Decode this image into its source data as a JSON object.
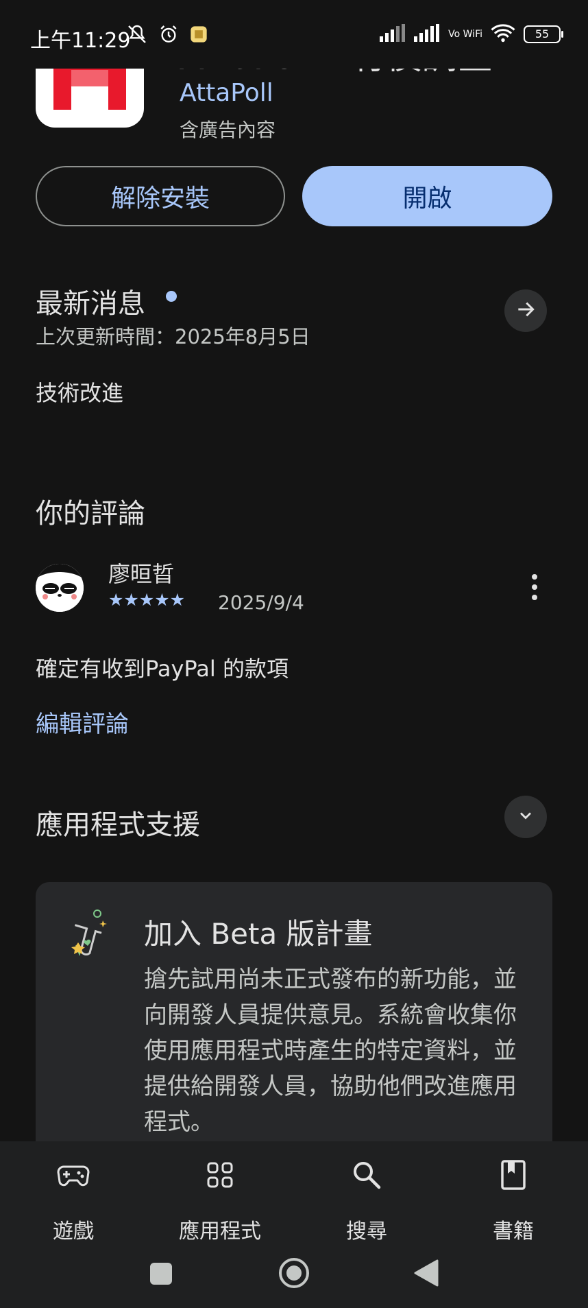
{
  "status_bar": {
    "time": "上午11:29",
    "battery": "55",
    "network_label": "Vo WiFi"
  },
  "app": {
    "title": "AttaPoll - 有償調查",
    "developer": "AttaPoll",
    "ads_note": "含廣告內容",
    "uninstall_label": "解除安裝",
    "open_label": "開啟",
    "icon_color": "#e8192c"
  },
  "whats_new": {
    "title": "最新消息",
    "updated": "上次更新時間：2025年8月5日",
    "notes": "技術改進"
  },
  "your_review": {
    "title": "你的評論",
    "reviewer": "廖晅晢",
    "rating": 5,
    "stars": "★★★★★",
    "date": "2025/9/4",
    "text": "確定有收到PayPal 的款項",
    "edit_label": "編輯評論"
  },
  "app_support": {
    "title": "應用程式支援"
  },
  "beta": {
    "title": "加入 Beta 版計畫",
    "description": "搶先試用尚未正式發布的新功能，並向開發人員提供意見。系統會收集你使用應用程式時產生的特定資料，並提供給開發人員，協助他們改進應用程式。"
  },
  "bottom_nav": {
    "items": [
      {
        "label": "遊戲",
        "icon": "gamepad-icon"
      },
      {
        "label": "應用程式",
        "icon": "apps-grid-icon"
      },
      {
        "label": "搜尋",
        "icon": "search-icon"
      },
      {
        "label": "書籍",
        "icon": "book-icon"
      }
    ]
  },
  "colors": {
    "accent": "#a8c7fa",
    "background": "#141414",
    "card": "#27282a"
  }
}
